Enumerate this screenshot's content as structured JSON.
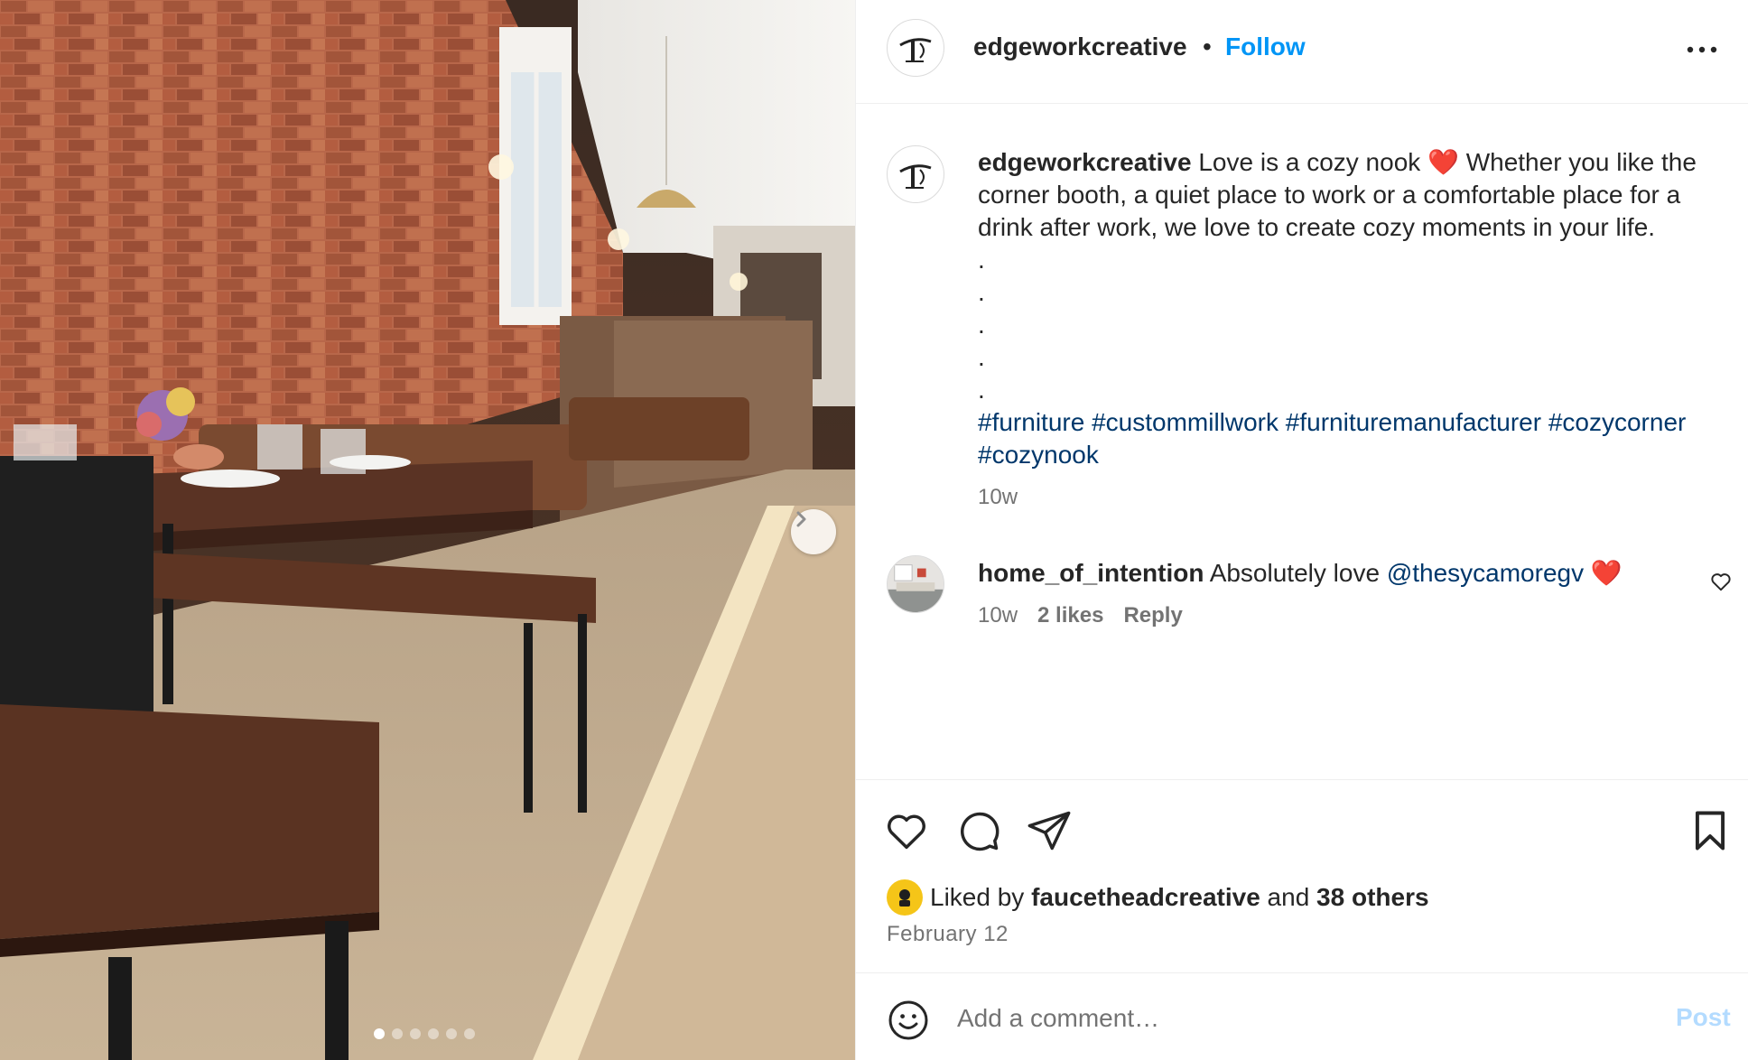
{
  "post": {
    "author": "edgeworkcreative",
    "separator": "•",
    "follow_label": "Follow",
    "more_icon": "more-horizontal-icon"
  },
  "caption": {
    "username": "edgeworkcreative",
    "text": "Love is a cozy nook ❤️ Whether you like the corner booth, a quiet place to work or a comfortable place for a drink after work, we love to create cozy moments in your life.",
    "dots": [
      ".",
      ".",
      ".",
      ".",
      "."
    ],
    "hashtags": [
      "#furniture",
      "#custommillwork",
      "#furnituremanufacturer",
      "#cozycorner",
      "#cozynook"
    ],
    "time": "10w"
  },
  "comment": {
    "username": "home_of_intention",
    "text": "Absolutely love",
    "mention": "@thesycamoregv",
    "emoji": "❤️",
    "time": "10w",
    "likes": "2 likes",
    "reply_label": "Reply"
  },
  "likes": {
    "prefix": "Liked by",
    "liker": "faucetheadcreative",
    "and": "and",
    "others": "38 others"
  },
  "date": "February 12",
  "composer": {
    "placeholder": "Add a comment…",
    "post_label": "Post"
  },
  "carousel": {
    "total": 6,
    "active_index": 1
  },
  "colors": {
    "link_blue": "#0095f6",
    "hashtag_blue": "#00376b",
    "secondary_text": "#737373",
    "post_disabled": "#b3dbff"
  }
}
